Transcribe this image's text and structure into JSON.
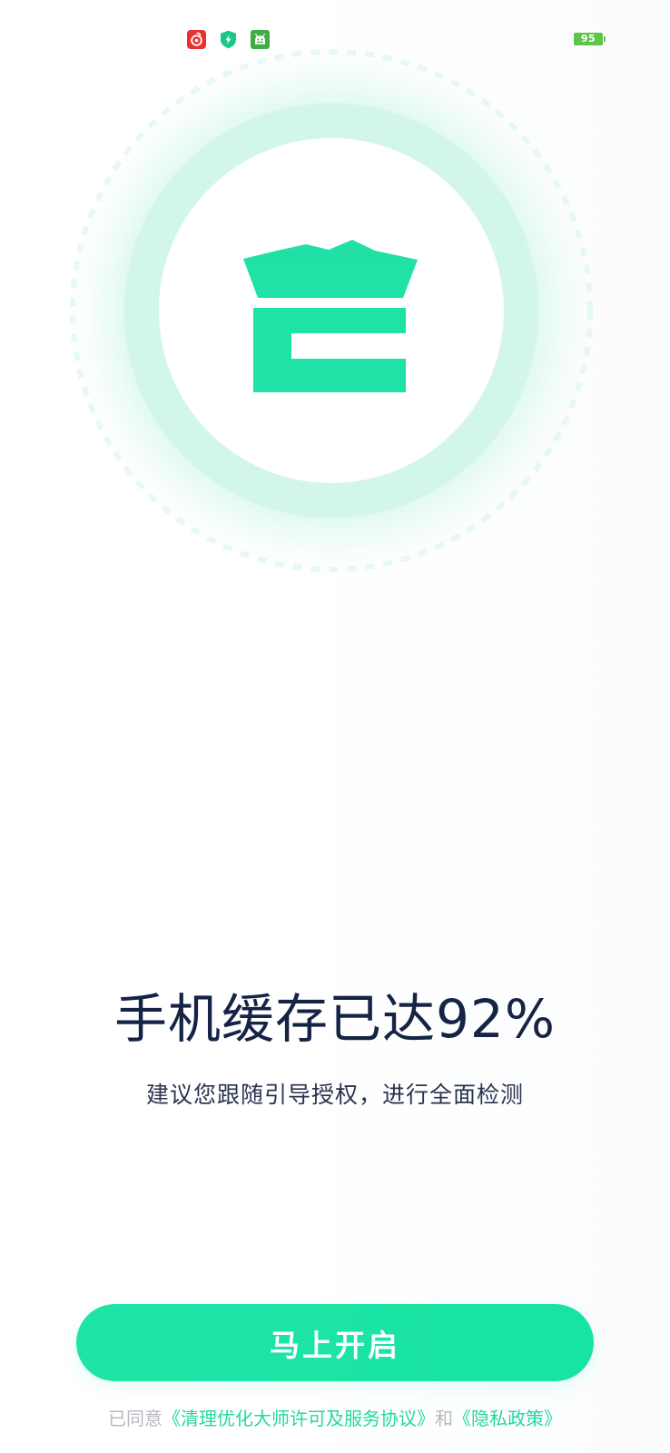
{
  "status_bar": {
    "icons": [
      "netease-music-icon",
      "security-shield-icon",
      "android-robot-icon"
    ],
    "battery_level": "95",
    "battery_color": "#5ec54b"
  },
  "colors": {
    "accent": "#19e3a5",
    "headline": "#152445",
    "subtitle": "#28344e",
    "muted": "#b6b9bf"
  },
  "main": {
    "headline": "手机缓存已达92%",
    "subtitle": "建议您跟随引导授权，进行全面检测",
    "cta_label": "马上开启"
  },
  "agreement": {
    "prefix": "已同意",
    "license_link": "《清理优化大师许可及服务协议》",
    "conjunction": "和",
    "privacy_link": "《隐私政策》"
  }
}
